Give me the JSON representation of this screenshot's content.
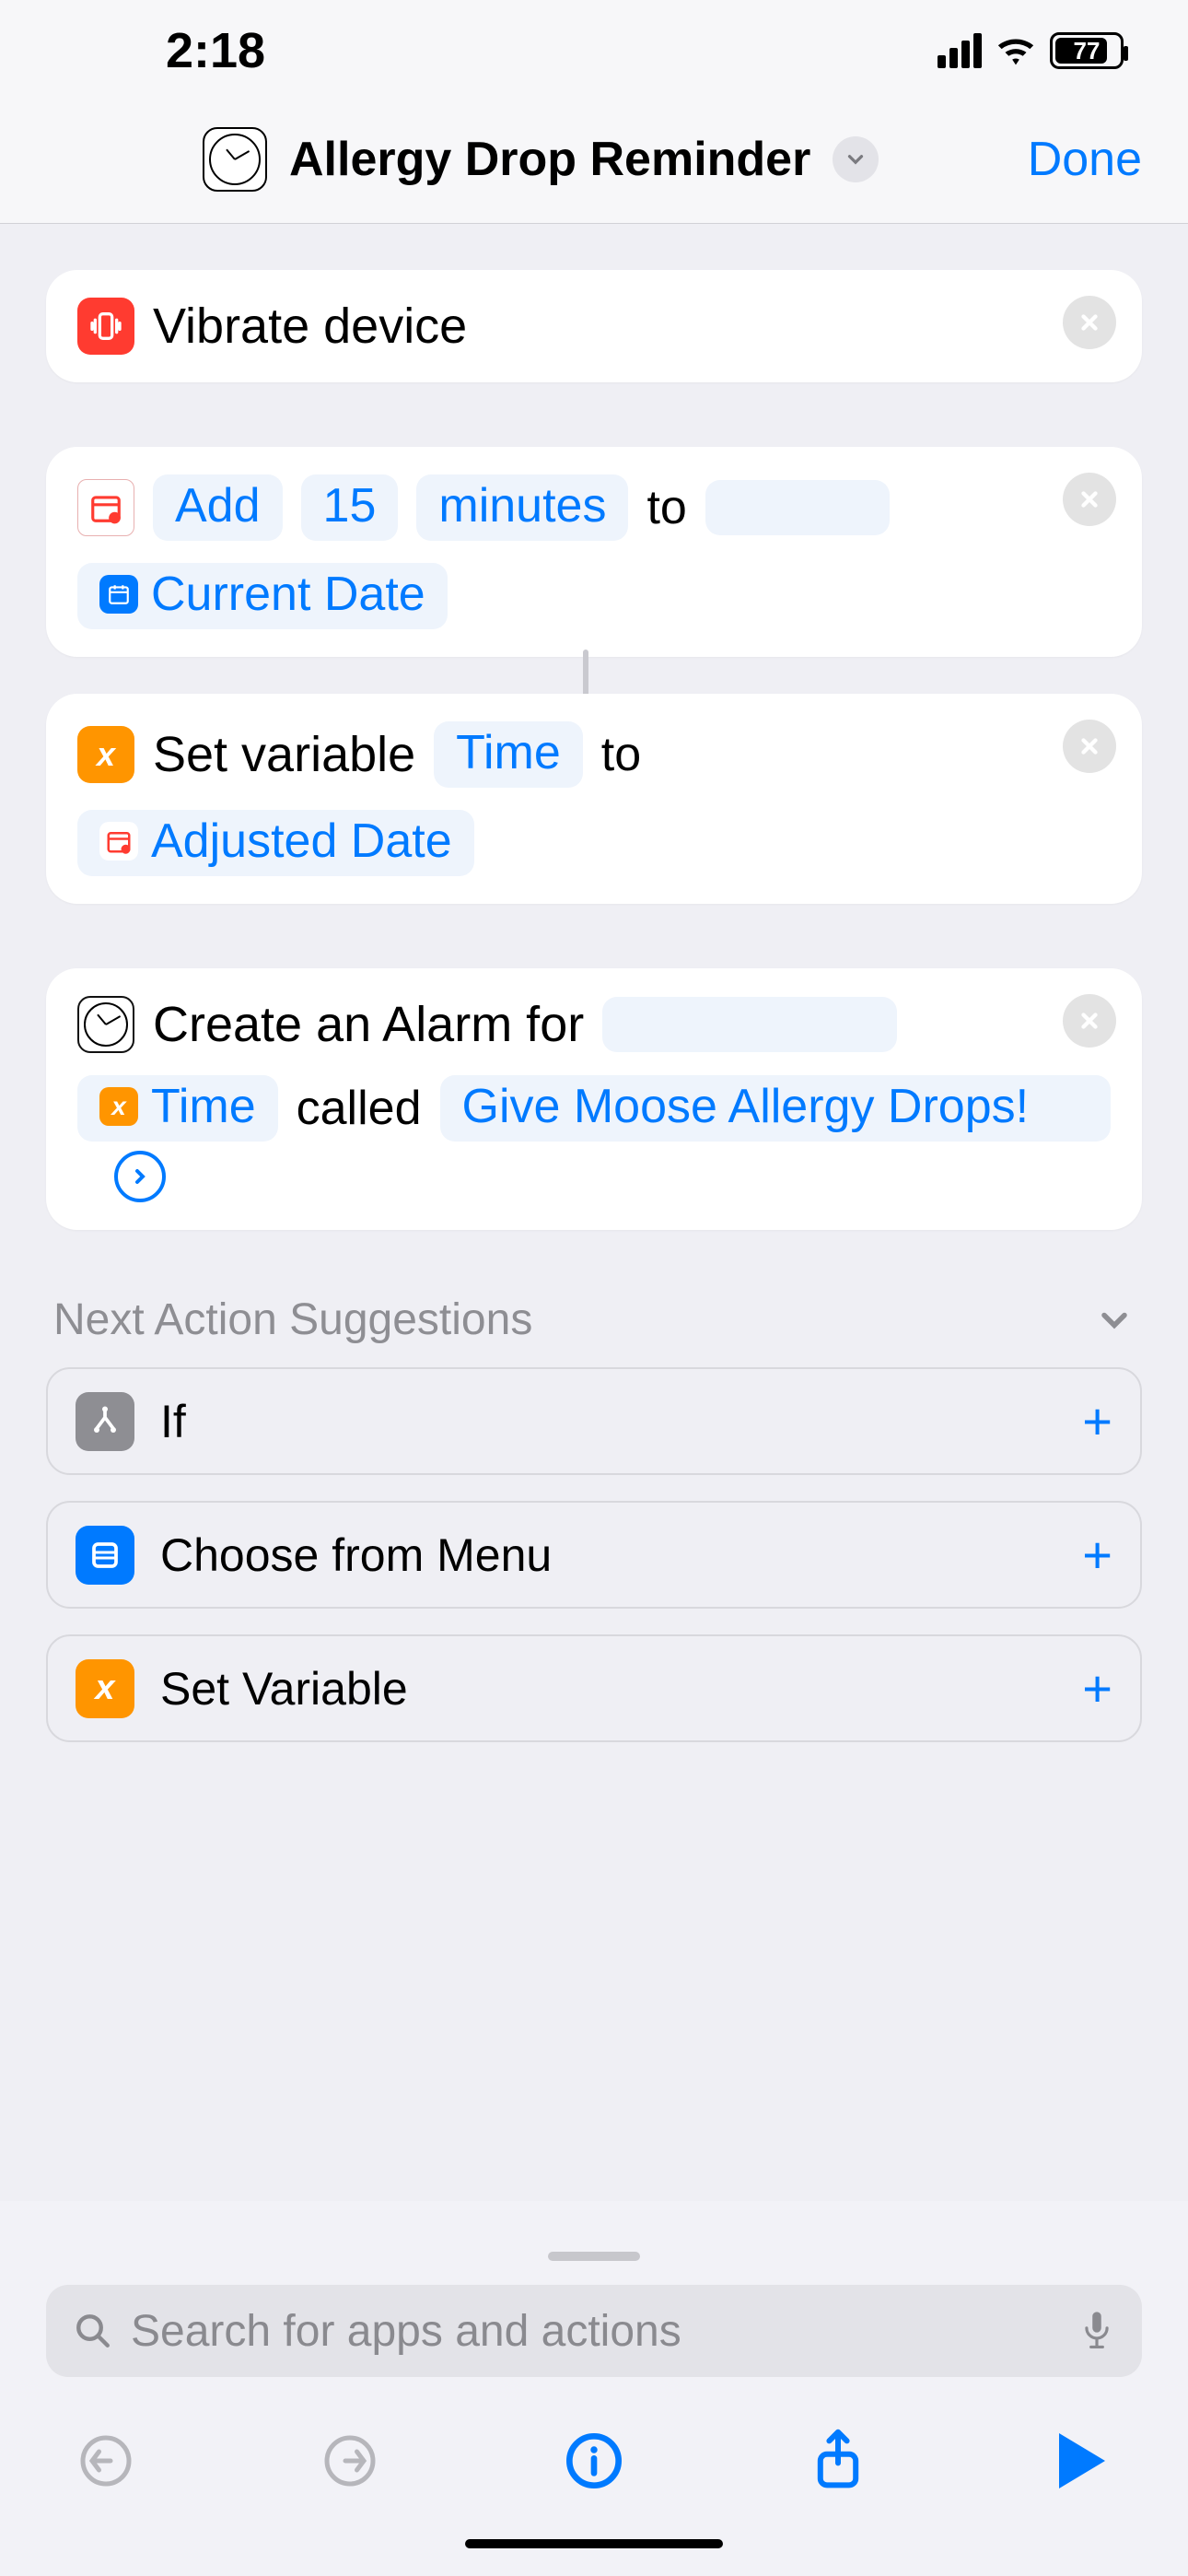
{
  "status": {
    "time": "2:18",
    "battery": "77"
  },
  "header": {
    "title": "Allergy Drop Reminder",
    "done": "Done"
  },
  "actions": {
    "vibrate": {
      "label": "Vibrate device"
    },
    "add_time": {
      "verb": "Add",
      "amount": "15",
      "unit": "minutes",
      "to": "to",
      "target": "Current Date"
    },
    "set_var": {
      "prefix": "Set variable",
      "var_name": "Time",
      "to": "to",
      "value": "Adjusted Date"
    },
    "alarm": {
      "prefix": "Create an Alarm for",
      "time_var": "Time",
      "called_word": "called",
      "alarm_name": "Give Moose Allergy Drops!"
    }
  },
  "suggestions": {
    "heading": "Next Action Suggestions",
    "items": [
      "If",
      "Choose from Menu",
      "Set Variable"
    ]
  },
  "search": {
    "placeholder": "Search for apps and actions"
  }
}
